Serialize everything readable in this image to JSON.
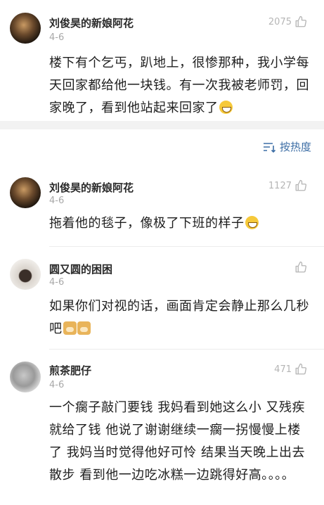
{
  "top_comment": {
    "username": "刘俊昊的新娘阿花",
    "date": "4-6",
    "likes": "2075",
    "text": "楼下有个乞丐，趴地上，很惨那种，我小学每天回家都给他一块钱。有一次我被老师罚，回家晚了，看到他站起来回家了"
  },
  "sort": {
    "label": "按热度",
    "icon": "sort-icon"
  },
  "replies": [
    {
      "username": "刘俊昊的新娘阿花",
      "date": "4-6",
      "likes": "1127",
      "text": "拖着他的毯子，像极了下班的样子"
    },
    {
      "username": "圆又圆的困困",
      "date": "4-6",
      "likes": "",
      "text": "如果你们对视的话，画面肯定会静止那么几秒吧"
    },
    {
      "username": "煎茶肥仔",
      "date": "4-6",
      "likes": "471",
      "text": "一个瘸子敲门要钱 我妈看到她这么小 又残疾 就给了钱 他说了谢谢继续一瘸一拐慢慢上楼了 我妈当时觉得他好可怜 结果当天晚上出去散步 看到他一边吃冰糕一边跳得好高。。。。"
    }
  ],
  "colors": {
    "link_blue": "#3d6ea5",
    "muted": "#a8a8a8",
    "divider": "#f2f2f2"
  }
}
